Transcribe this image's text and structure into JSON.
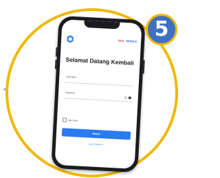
{
  "step_badge": {
    "number": "5",
    "color": "#3f6fc4",
    "ring_color": "#f0b800"
  },
  "screen": {
    "brands": {
      "left": "BCA",
      "right": "MOBILE"
    },
    "title": "Selamat Datang Kembali",
    "username": {
      "label": "",
      "value": "Username"
    },
    "password": {
      "label": "",
      "value": "Password"
    },
    "remember_label": "Ingat Saya",
    "login_button": "Masuk",
    "forgot_link": "Lupa Password",
    "accent_color": "#2a7bf0"
  }
}
